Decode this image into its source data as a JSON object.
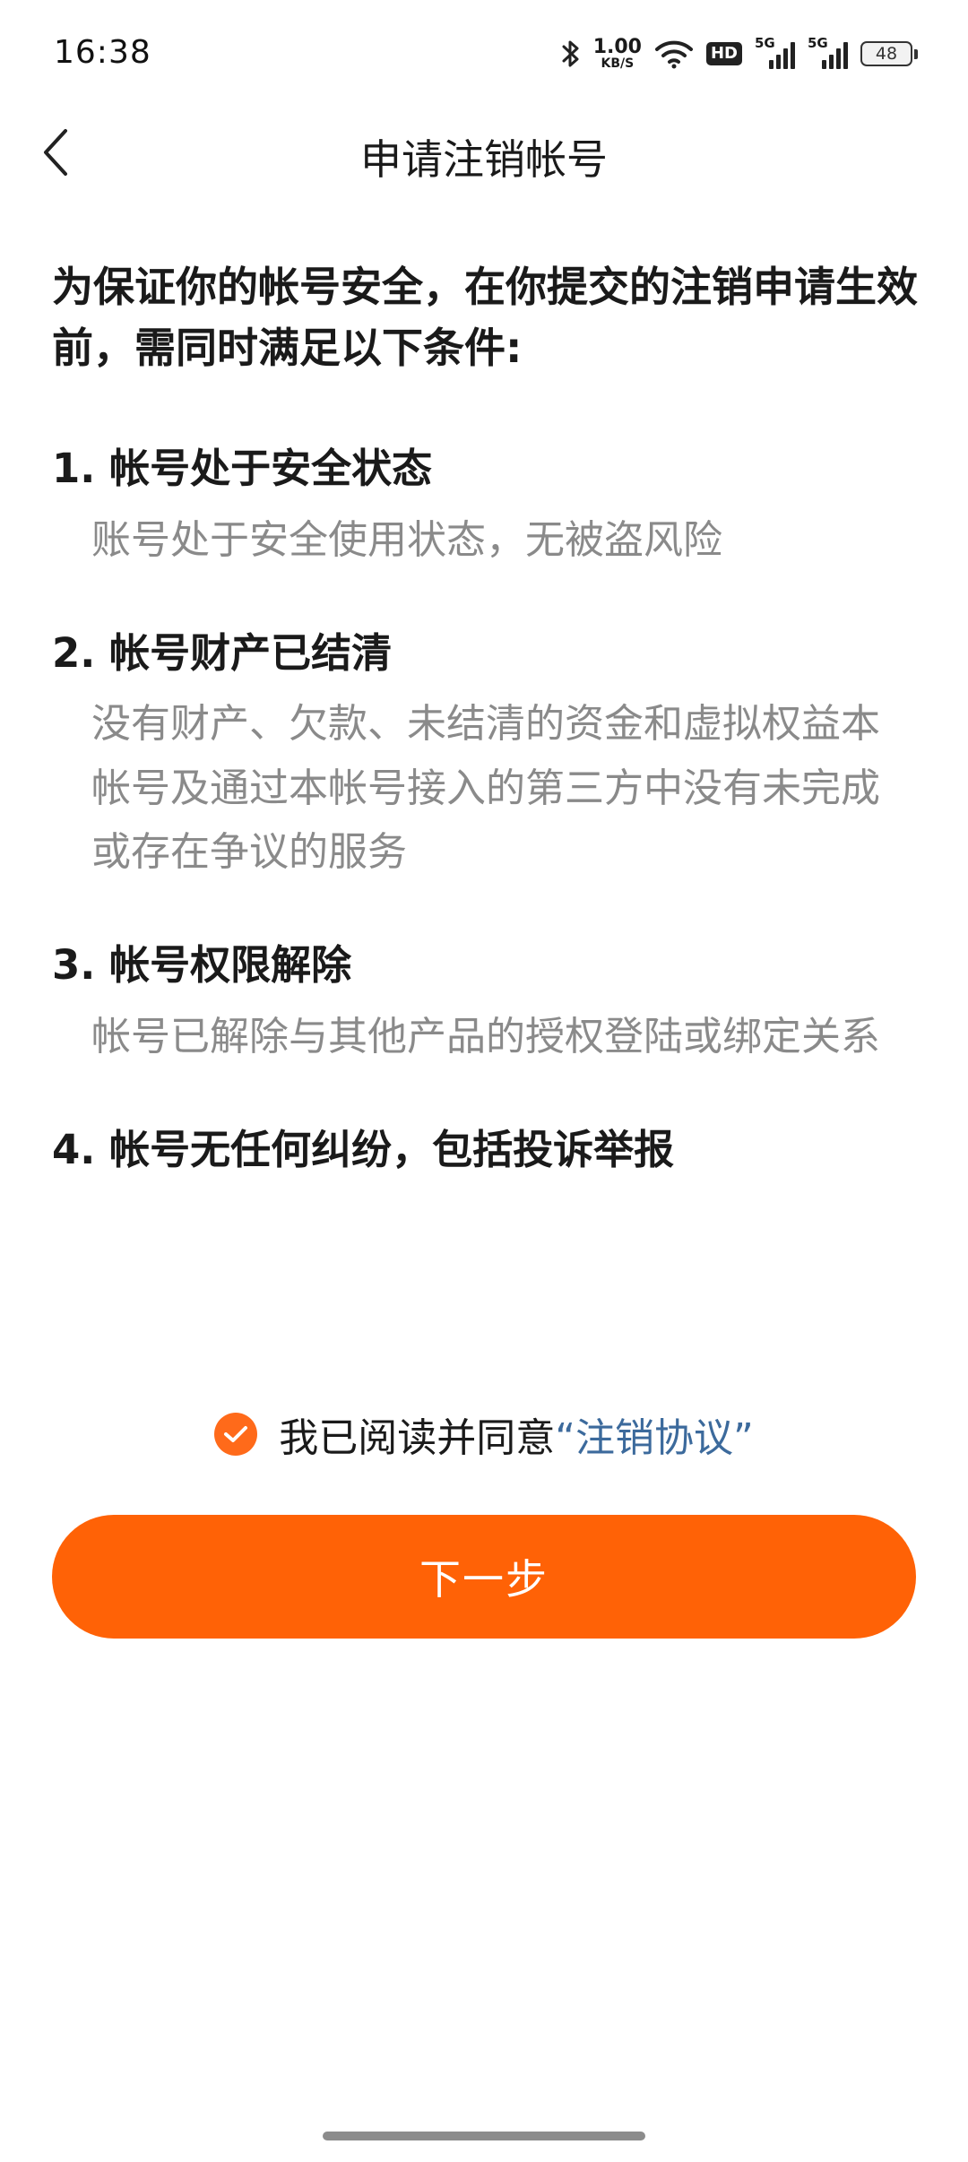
{
  "status_bar": {
    "time": "16:38",
    "net_speed_value": "1.00",
    "net_speed_unit": "KB/S",
    "hd_label": "HD",
    "sim1_label": "5G",
    "sim2_label": "5G",
    "battery_level": "48"
  },
  "header": {
    "title": "申请注销帐号"
  },
  "intro": "为保证你的帐号安全，在你提交的注销申请生效前，需同时满足以下条件:",
  "conditions": [
    {
      "title": "1. 帐号处于安全状态",
      "description": "账号处于安全使用状态，无被盗风险"
    },
    {
      "title": "2. 帐号财产已结清",
      "description": "没有财产、欠款、未结清的资金和虚拟权益本帐号及通过本帐号接入的第三方中没有未完成或存在争议的服务"
    },
    {
      "title": "3. 帐号权限解除",
      "description": "帐号已解除与其他产品的授权登陆或绑定关系"
    },
    {
      "title": "4. 帐号无任何纠纷，包括投诉举报",
      "description": ""
    }
  ],
  "agreement": {
    "text": "我已阅读并同意",
    "link": "“注销协议”",
    "checked": true
  },
  "next_button": {
    "label": "下一步"
  },
  "colors": {
    "accent": "#ff6206",
    "link": "#3c6a9c",
    "secondary_text": "#8a8a8a"
  }
}
